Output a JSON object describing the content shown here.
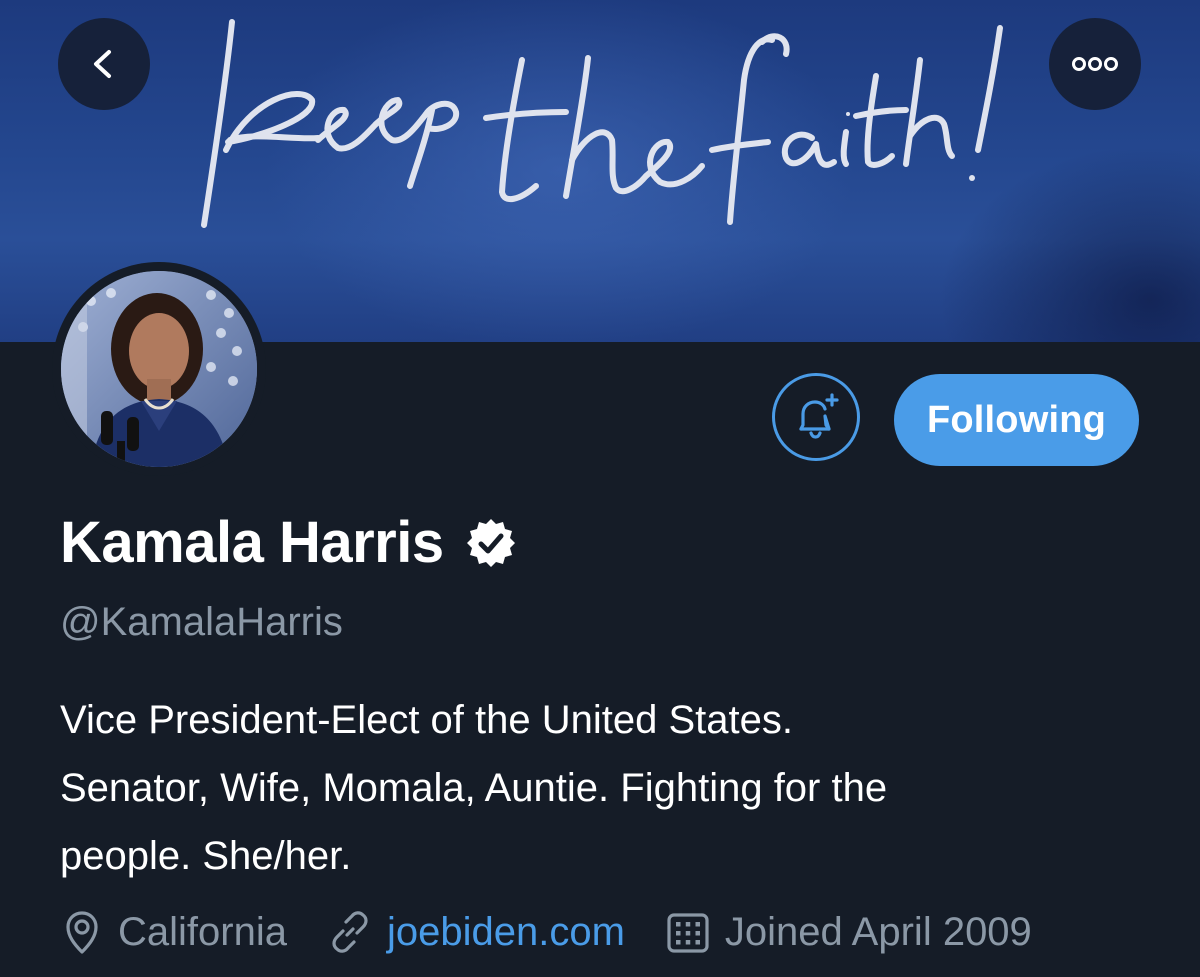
{
  "banner": {
    "handwritten_text": "keep the faith!"
  },
  "header": {
    "back_icon": "chevron-left-icon",
    "more_icon": "more-horizontal-icon"
  },
  "profile": {
    "display_name": "Kamala Harris",
    "verified_icon": "verified-badge-icon",
    "handle": "@KamalaHarris",
    "bio_lines": [
      "Vice President-Elect of the United States.",
      "Senator, Wife, Momala, Auntie. Fighting for the",
      "people. She/her."
    ],
    "following_label": "Following",
    "notify_icon": "bell-plus-icon",
    "location": "California",
    "website": "joebiden.com",
    "joined": "Joined April 2009"
  },
  "colors": {
    "background": "#151c27",
    "accent": "#4a9ce8",
    "secondary_text": "#8b98a6",
    "primary_text": "#ffffff",
    "banner_blue": "#24478f"
  }
}
